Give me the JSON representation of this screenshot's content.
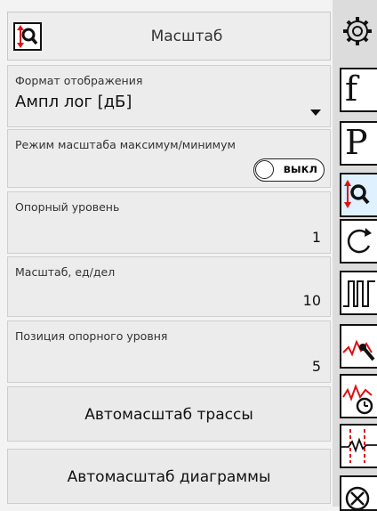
{
  "header": {
    "title": "Масштаб",
    "icon": "zoom-scale-icon"
  },
  "fields": {
    "display_format": {
      "label": "Формат отображения",
      "value": "Ампл лог [дБ]"
    },
    "scale_mode": {
      "label": "Режим масштаба максимум/минимум",
      "toggle_label": "выкл",
      "state": "off"
    },
    "ref_level": {
      "label": "Опорный уровень",
      "value": "1"
    },
    "scale_per_div": {
      "label": "Масштаб, ед/дел",
      "value": "10"
    },
    "ref_position": {
      "label": "Позиция опорного уровня",
      "value": "5"
    }
  },
  "buttons": {
    "autoscale_trace": "Автомасштаб трассы",
    "autoscale_diagram": "Автомасштаб диаграммы"
  },
  "sidebar": {
    "items": [
      {
        "icon": "gear-icon"
      },
      {
        "icon": "frequency-f-icon",
        "glyph": "f"
      },
      {
        "icon": "power-p-icon",
        "glyph": "P"
      },
      {
        "icon": "zoom-scale-icon",
        "active": true
      },
      {
        "icon": "sweep-cycle-icon"
      },
      {
        "icon": "pulse-trigger-icon"
      },
      {
        "icon": "marker-trace-icon"
      },
      {
        "icon": "trace-time-icon"
      },
      {
        "icon": "limit-lines-icon"
      },
      {
        "icon": "close-circle-icon"
      }
    ]
  },
  "colors": {
    "accent": "#d11",
    "active_bg": "#dff0ff"
  }
}
